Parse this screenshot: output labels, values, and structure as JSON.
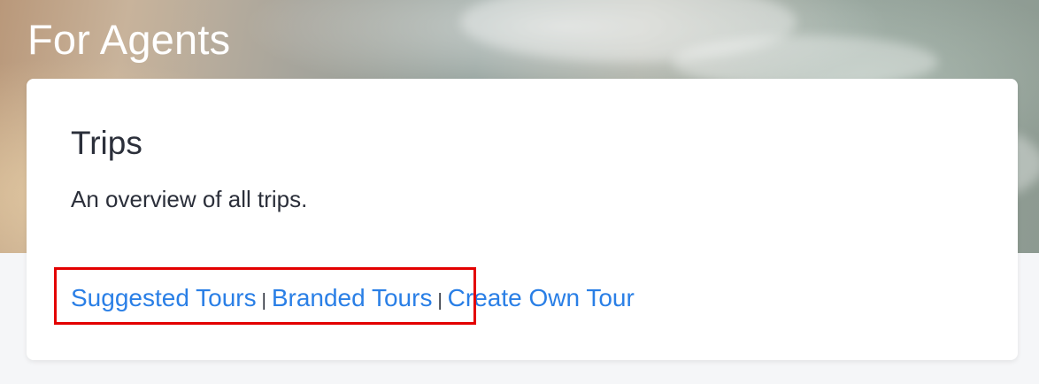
{
  "hero": {
    "title": "For Agents"
  },
  "card": {
    "title": "Trips",
    "description": "An overview of all trips.",
    "links": [
      {
        "label": "Suggested Tours"
      },
      {
        "label": "Branded Tours"
      },
      {
        "label": "Create Own Tour"
      }
    ],
    "separator": "|"
  },
  "colors": {
    "link": "#2a7fe6",
    "text": "#2b2f3a",
    "highlight": "#e30000",
    "card_bg": "#ffffff"
  }
}
